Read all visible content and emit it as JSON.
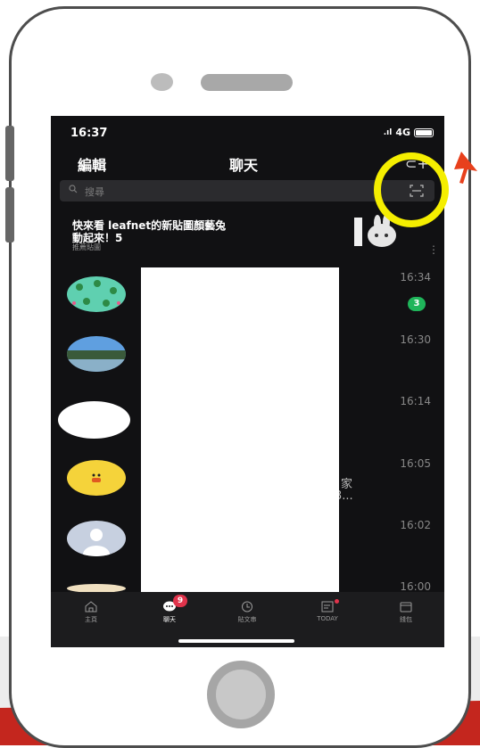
{
  "status_bar": {
    "time": "16:37",
    "network": "4G"
  },
  "nav": {
    "left": "編輯",
    "title": "聊天"
  },
  "search": {
    "placeholder": "搜尋"
  },
  "promo": {
    "line1": "快來看 leafnet的新貼圖顏藝兔",
    "line2": "動起來！5",
    "subtitle": "推薦貼圖"
  },
  "chats": [
    {
      "time": "16:34",
      "unread": "3"
    },
    {
      "time": "16:30"
    },
    {
      "time": "16:14"
    },
    {
      "time": "16:05"
    },
    {
      "time": "16:02"
    },
    {
      "time": "16:00"
    }
  ],
  "partial_text": {
    "line1": "家",
    "line2": "3..."
  },
  "tabbar": {
    "items": [
      {
        "label": "主頁",
        "icon": "home-icon"
      },
      {
        "label": "聊天",
        "icon": "chat-icon",
        "badge": "9"
      },
      {
        "label": "貼文串",
        "icon": "clock-icon"
      },
      {
        "label": "TODAY",
        "icon": "news-icon"
      },
      {
        "label": "錢包",
        "icon": "wallet-icon"
      }
    ]
  },
  "colors": {
    "highlight": "#f5ee00",
    "arrow": "#e8401c",
    "unread_badge": "#1fb55a",
    "tab_badge": "#e0334b"
  }
}
